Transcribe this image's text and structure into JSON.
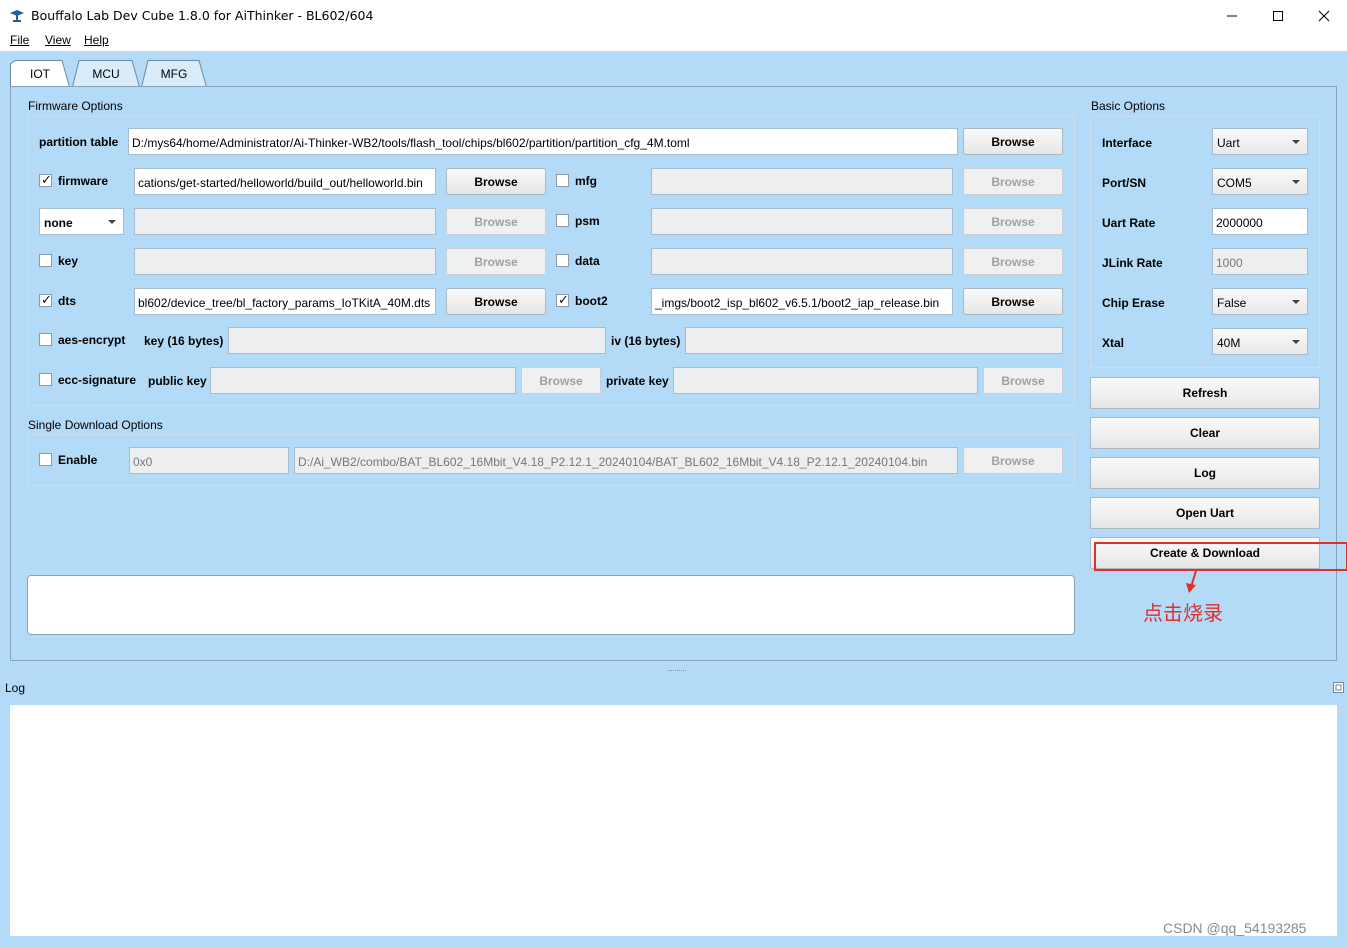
{
  "window": {
    "title": "Bouffalo Lab Dev Cube 1.8.0 for AiThinker - BL602/604"
  },
  "menu": [
    "File",
    "View",
    "Help"
  ],
  "tabs": [
    "IOT",
    "MCU",
    "MFG"
  ],
  "active_tab": "IOT",
  "firmware_options": {
    "group_label": "Firmware Options",
    "partition_table_label": "partition table",
    "partition_table_value": "D:/mys64/home/Administrator/Ai-Thinker-WB2/tools/flash_tool/chips/bl602/partition/partition_cfg_4M.toml",
    "browse": "Browse",
    "firmware_label": "firmware",
    "firmware_checked": true,
    "firmware_value": "cations/get-started/helloworld/build_out/helloworld.bin",
    "mfg_label": "mfg",
    "mfg_checked": false,
    "media_select": "none",
    "psm_label": "psm",
    "psm_checked": false,
    "key_label": "key",
    "key_checked": false,
    "data_label": "data",
    "data_checked": false,
    "dts_label": "dts",
    "dts_checked": true,
    "dts_value": "bl602/device_tree/bl_factory_params_IoTKitA_40M.dts",
    "boot2_label": "boot2",
    "boot2_checked": true,
    "boot2_value": "_imgs/boot2_isp_bl602_v6.5.1/boot2_iap_release.bin",
    "aes_label": "aes-encrypt",
    "aes_checked": false,
    "aes_key_label": "key (16 bytes)",
    "aes_iv_label": "iv (16 bytes)",
    "ecc_label": "ecc-signature",
    "ecc_checked": false,
    "public_key_label": "public key",
    "private_key_label": "private key"
  },
  "single_download": {
    "group_label": "Single Download Options",
    "enable_label": "Enable",
    "enable_checked": false,
    "address_value": "0x0",
    "path_value": "D:/Ai_WB2/combo/BAT_BL602_16Mbit_V4.18_P2.12.1_20240104/BAT_BL602_16Mbit_V4.18_P2.12.1_20240104.bin",
    "browse": "Browse"
  },
  "basic_options": {
    "group_label": "Basic Options",
    "rows": [
      {
        "label": "Interface",
        "value": "Uart",
        "kind": "combo"
      },
      {
        "label": "Port/SN",
        "value": "COM5",
        "kind": "combo"
      },
      {
        "label": "Uart Rate",
        "value": "2000000",
        "kind": "input"
      },
      {
        "label": "JLink Rate",
        "value": "1000",
        "kind": "input-disabled"
      },
      {
        "label": "Chip Erase",
        "value": "False",
        "kind": "combo"
      },
      {
        "label": "Xtal",
        "value": "40M",
        "kind": "combo"
      }
    ]
  },
  "actions": [
    "Refresh",
    "Clear",
    "Log",
    "Open Uart",
    "Create & Download"
  ],
  "log": {
    "label": "Log"
  },
  "annotation": {
    "text": "点击烧录",
    "color": "#e0302a"
  },
  "watermark": "CSDN @qq_54193285"
}
